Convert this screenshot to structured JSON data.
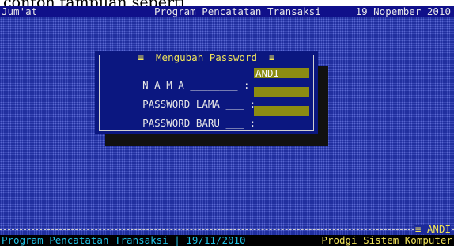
{
  "caption": "contoh tampilan seperti,",
  "topbar": {
    "day": "Jum'at",
    "title": "Program Pencatatan Transaksi",
    "date": "19 Nopember 2010"
  },
  "dialog": {
    "title": "≡  Mengubah Password  ≡",
    "fields": [
      {
        "label": "N A M A ________ :",
        "value": "ANDI"
      },
      {
        "label": "PASSWORD LAMA ___ :",
        "value": ""
      },
      {
        "label": "PASSWORD BARU ___ :",
        "value": ""
      }
    ]
  },
  "bottom_user": "≡ ANDI",
  "statusbar": {
    "left": "Program Pencatatan Transaksi | 19/11/2010",
    "right": "Prodgi Sistem Komputer"
  },
  "colors": {
    "desktop": "#1c2a9a",
    "dialog": "#0b1780",
    "field": "#8c8c12",
    "accent_yellow": "#f2e55a",
    "status_cyan": "#22c4e8"
  }
}
